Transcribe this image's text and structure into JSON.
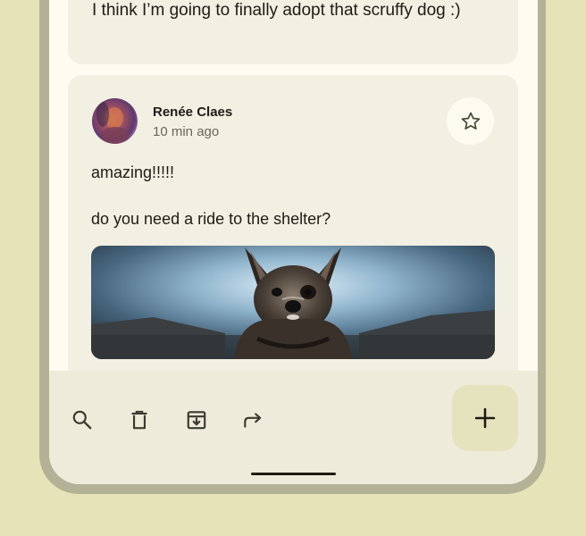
{
  "feed": {
    "previous_post": {
      "body": "I think I’m going to finally adopt that scruffy dog :)"
    },
    "post": {
      "author": "Renée Claes",
      "time": "10 min ago",
      "body_lines": [
        "amazing!!!!!",
        "do you need a ride to the shelter?"
      ],
      "attachment": "dog-photo"
    }
  },
  "toolbar": {
    "actions": [
      "search-icon",
      "delete-icon",
      "archive-icon",
      "forward-icon"
    ],
    "fab_icon": "add-icon"
  },
  "colors": {
    "background": "#e6e3b8",
    "card": "#f2efe3",
    "surface": "#fefbf1",
    "toolbar": "#efebdb",
    "fab": "#e5e3be",
    "on_surface": "#1e1c14",
    "muted": "#6b6858"
  }
}
